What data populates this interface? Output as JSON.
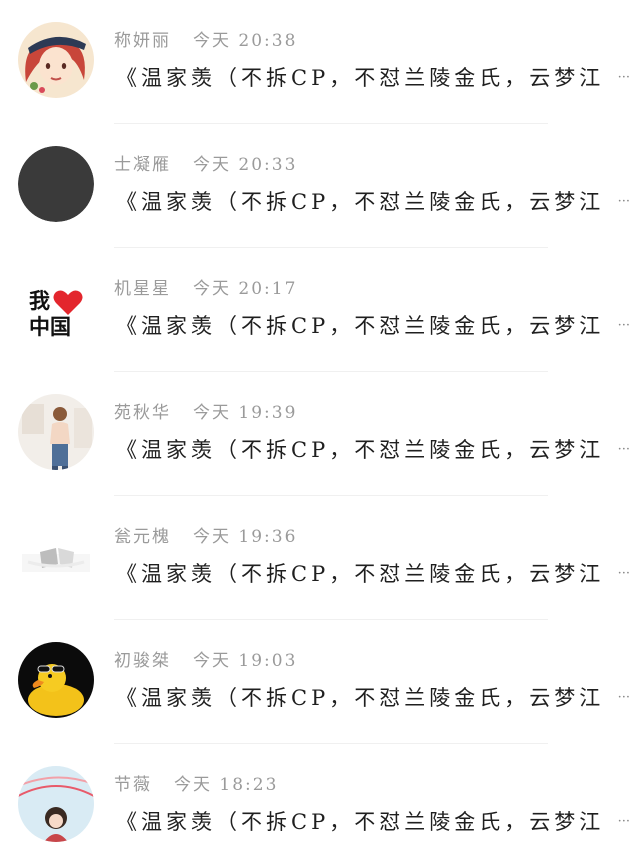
{
  "comments": [
    {
      "name": "称妍丽",
      "time": "今天 20:38",
      "text": "《温家羡（不拆CP，不怼兰陵金氏，云梦江",
      "avatar": "cartoon-girl-hat-avatar"
    },
    {
      "name": "士凝雁",
      "time": "今天 20:33",
      "text": "《温家羡（不拆CP，不怼兰陵金氏，云梦江",
      "avatar": "dark-gray-circle-avatar"
    },
    {
      "name": "机星星",
      "time": "今天 20:17",
      "text": "《温家羡（不拆CP，不怼兰陵金氏，云梦江",
      "avatar": "i-love-china-avatar",
      "avatar_text": [
        "我",
        "中国"
      ]
    },
    {
      "name": "苑秋华",
      "time": "今天 19:39",
      "text": "《温家羡（不拆CP，不怼兰陵金氏，云梦江",
      "avatar": "woman-photo-avatar"
    },
    {
      "name": "瓮元槐",
      "time": "今天 19:36",
      "text": "《温家羡（不拆CP，不怼兰陵金氏，云梦江",
      "avatar": "gray-shapes-avatar"
    },
    {
      "name": "初骏桀",
      "time": "今天 19:03",
      "text": "《温家羡（不拆CP，不怼兰陵金氏，云梦江",
      "avatar": "rubber-duck-sunglasses-avatar"
    },
    {
      "name": "节薇",
      "time": "今天 18:23",
      "text": "《温家羡（不拆CP，不怼兰陵金氏，云梦江",
      "avatar": "cartoon-girl-sky-avatar"
    }
  ],
  "ellipsis": "···",
  "colors": {
    "name_gray": "#9a9a9a",
    "text_dark": "#1f1f1f",
    "heart_red": "#e3262d"
  }
}
